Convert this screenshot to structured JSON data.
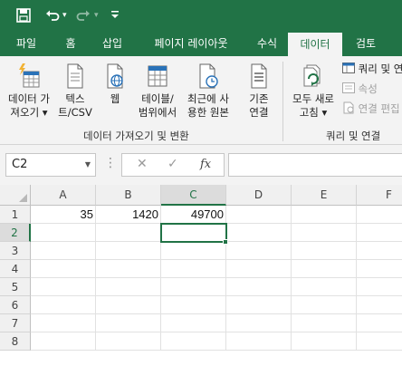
{
  "quick_access": {
    "save_icon": "save-icon",
    "undo_icon": "undo-icon",
    "redo_icon": "redo-icon",
    "dropdown_glyph": "▾"
  },
  "tabs": [
    {
      "label": "파일",
      "active": false
    },
    {
      "label": "홈",
      "active": false
    },
    {
      "label": "삽입",
      "active": false
    },
    {
      "label": "페이지 레이아웃",
      "active": false
    },
    {
      "label": "수식",
      "active": false
    },
    {
      "label": "데이터",
      "active": true
    },
    {
      "label": "검토",
      "active": false
    }
  ],
  "ribbon": {
    "get_data": {
      "line1": "데이터 가",
      "line2": "져오기 ▾"
    },
    "from_text": {
      "line1": "텍스",
      "line2": "트/CSV"
    },
    "from_web": {
      "line1": "웹"
    },
    "from_table": {
      "line1": "테이블/",
      "line2": "범위에서"
    },
    "recent_sources": {
      "line1": "최근에 사",
      "line2": "용한 원본"
    },
    "existing_connections": {
      "line1": "기존",
      "line2": "연결"
    },
    "group_get_transform": "데이터 가져오기 및 변환",
    "refresh_all": {
      "line1": "모두 새로",
      "line2": "고침 ▾"
    },
    "queries_connections": "쿼리 및 연",
    "properties": "속성",
    "edit_links": "연결 편집",
    "group_queries": "쿼리 및 연결"
  },
  "formula_bar": {
    "name_box": "C2",
    "cancel_glyph": "✕",
    "enter_glyph": "✓",
    "insert_function": "fx",
    "formula": ""
  },
  "sheet": {
    "columns": [
      "A",
      "B",
      "C",
      "D",
      "E",
      "F"
    ],
    "rows": [
      "1",
      "2",
      "3",
      "4",
      "5",
      "6",
      "7",
      "8"
    ],
    "cells": {
      "A1": "35",
      "B1": "1420",
      "C1": "49700"
    },
    "active_cell": "C2",
    "accent": "#217346"
  }
}
